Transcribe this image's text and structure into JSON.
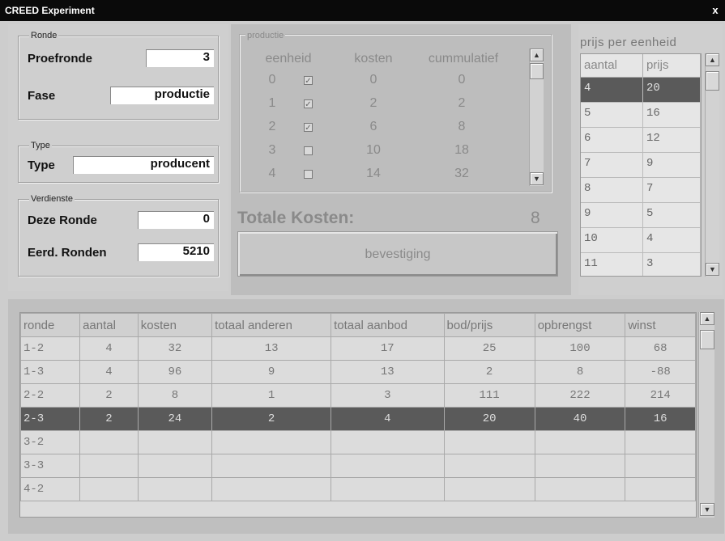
{
  "window": {
    "title": "CREED Experiment",
    "close_glyph": "x"
  },
  "ronde": {
    "legend": "Ronde",
    "proefronde_label": "Proefronde",
    "proefronde_value": "3",
    "fase_label": "Fase",
    "fase_value": "productie"
  },
  "type": {
    "legend": "Type",
    "label": "Type",
    "value": "producent"
  },
  "verdienste": {
    "legend": "Verdienste",
    "deze_label": "Deze Ronde",
    "deze_value": "0",
    "eerd_label": "Eerd. Ronden",
    "eerd_value": "5210"
  },
  "productie": {
    "legend": "productie",
    "headers": [
      "eenheid",
      "kosten",
      "cummulatief"
    ],
    "rows": [
      {
        "eenheid": "0",
        "checked": true,
        "kosten": "0",
        "cumm": "0"
      },
      {
        "eenheid": "1",
        "checked": true,
        "kosten": "2",
        "cumm": "2"
      },
      {
        "eenheid": "2",
        "checked": true,
        "kosten": "6",
        "cumm": "8"
      },
      {
        "eenheid": "3",
        "checked": false,
        "kosten": "10",
        "cumm": "18"
      },
      {
        "eenheid": "4",
        "checked": false,
        "kosten": "14",
        "cumm": "32"
      }
    ]
  },
  "totale_kosten": {
    "label": "Totale Kosten:",
    "value": "8"
  },
  "bevestiging_label": "bevestiging",
  "prijs": {
    "title": "prijs per eenheid",
    "headers": [
      "aantal",
      "prijs"
    ],
    "rows": [
      {
        "aantal": "4",
        "prijs": "20",
        "selected": true
      },
      {
        "aantal": "5",
        "prijs": "16"
      },
      {
        "aantal": "6",
        "prijs": "12"
      },
      {
        "aantal": "7",
        "prijs": "9"
      },
      {
        "aantal": "8",
        "prijs": "7"
      },
      {
        "aantal": "9",
        "prijs": "5"
      },
      {
        "aantal": "10",
        "prijs": "4"
      },
      {
        "aantal": "11",
        "prijs": "3"
      }
    ]
  },
  "results": {
    "headers": [
      "ronde",
      "aantal",
      "kosten",
      "totaal anderen",
      "totaal aanbod",
      "bod/prijs",
      "opbrengst",
      "winst"
    ],
    "rows": [
      [
        "1-2",
        "4",
        "32",
        "13",
        "17",
        "25",
        "100",
        "68"
      ],
      [
        "1-3",
        "4",
        "96",
        "9",
        "13",
        "2",
        "8",
        "-88"
      ],
      [
        "2-2",
        "2",
        "8",
        "1",
        "3",
        "111",
        "222",
        "214"
      ],
      [
        "2-3",
        "2",
        "24",
        "2",
        "4",
        "20",
        "40",
        "16"
      ],
      [
        "3-2",
        "",
        "",
        "",
        "",
        "",
        "",
        ""
      ],
      [
        "3-3",
        "",
        "",
        "",
        "",
        "",
        "",
        ""
      ],
      [
        "4-2",
        "",
        "",
        "",
        "",
        "",
        "",
        ""
      ]
    ],
    "selected_index": 3
  },
  "scroll_up_glyph": "▲",
  "scroll_down_glyph": "▼",
  "check_glyph": "✓"
}
